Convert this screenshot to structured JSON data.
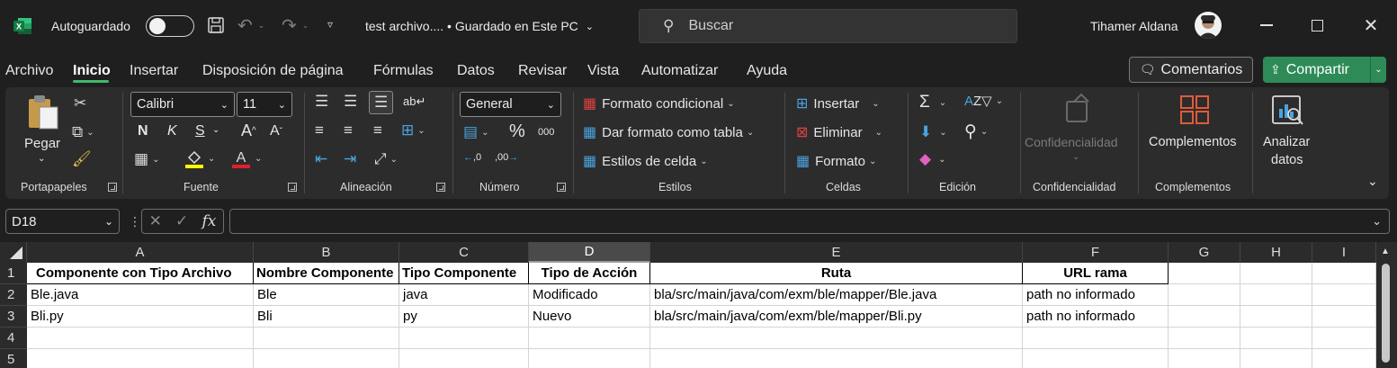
{
  "titlebar": {
    "autosave_label": "Autoguardado",
    "file_title": "test archivo.... • Guardado en Este PC",
    "search_placeholder": "Buscar",
    "user_name": "Tihamer Aldana"
  },
  "menu": {
    "items": [
      "Archivo",
      "Inicio",
      "Insertar",
      "Disposición de página",
      "Fórmulas",
      "Datos",
      "Revisar",
      "Vista",
      "Automatizar",
      "Ayuda"
    ],
    "active": "Inicio",
    "comments_label": "Comentarios",
    "share_label": "Compartir"
  },
  "ribbon": {
    "clipboard": {
      "paste": "Pegar",
      "label": "Portapapeles"
    },
    "font": {
      "family": "Calibri",
      "size": "11",
      "bold": "N",
      "italic": "K",
      "underline": "S",
      "label": "Fuente"
    },
    "alignment": {
      "label": "Alineación"
    },
    "number": {
      "format": "General",
      "label": "Número"
    },
    "styles": {
      "conditional": "Formato condicional",
      "as_table": "Dar formato como tabla",
      "cell_styles": "Estilos de celda",
      "label": "Estilos"
    },
    "cells": {
      "insert": "Insertar",
      "delete": "Eliminar",
      "format": "Formato",
      "label": "Celdas"
    },
    "editing": {
      "label": "Edición"
    },
    "sensitivity": {
      "button": "Confidencialidad",
      "label": "Confidencialidad"
    },
    "addins": {
      "button": "Complementos",
      "label": "Complementos"
    },
    "analyze": {
      "line1": "Analizar",
      "line2": "datos"
    }
  },
  "formula_bar": {
    "name_box": "D18",
    "fx": "fx",
    "value": ""
  },
  "grid": {
    "columns": [
      "A",
      "B",
      "C",
      "D",
      "E",
      "F",
      "G",
      "H",
      "I"
    ],
    "selected_column": "D",
    "rows": [
      "1",
      "2",
      "3",
      "4",
      "5"
    ],
    "header": [
      "Componente con Tipo Archivo",
      "Nombre Componente",
      "Tipo Componente",
      "Tipo de Acción",
      "Ruta",
      "URL rama"
    ],
    "data": [
      [
        "Ble.java",
        "Ble",
        "java",
        "Modificado",
        "bla/src/main/java/com/exm/ble/mapper/Ble.java",
        "path no informado"
      ],
      [
        "Bli.py",
        "Bli",
        "py",
        "Nuevo",
        "bla/src/main/java/com/exm/ble/mapper/Bli.py",
        "path no informado"
      ]
    ]
  },
  "colors": {
    "accent_green": "#2e8b57",
    "tab_underline": "#3fb96b",
    "excel_green": "#107c41"
  }
}
